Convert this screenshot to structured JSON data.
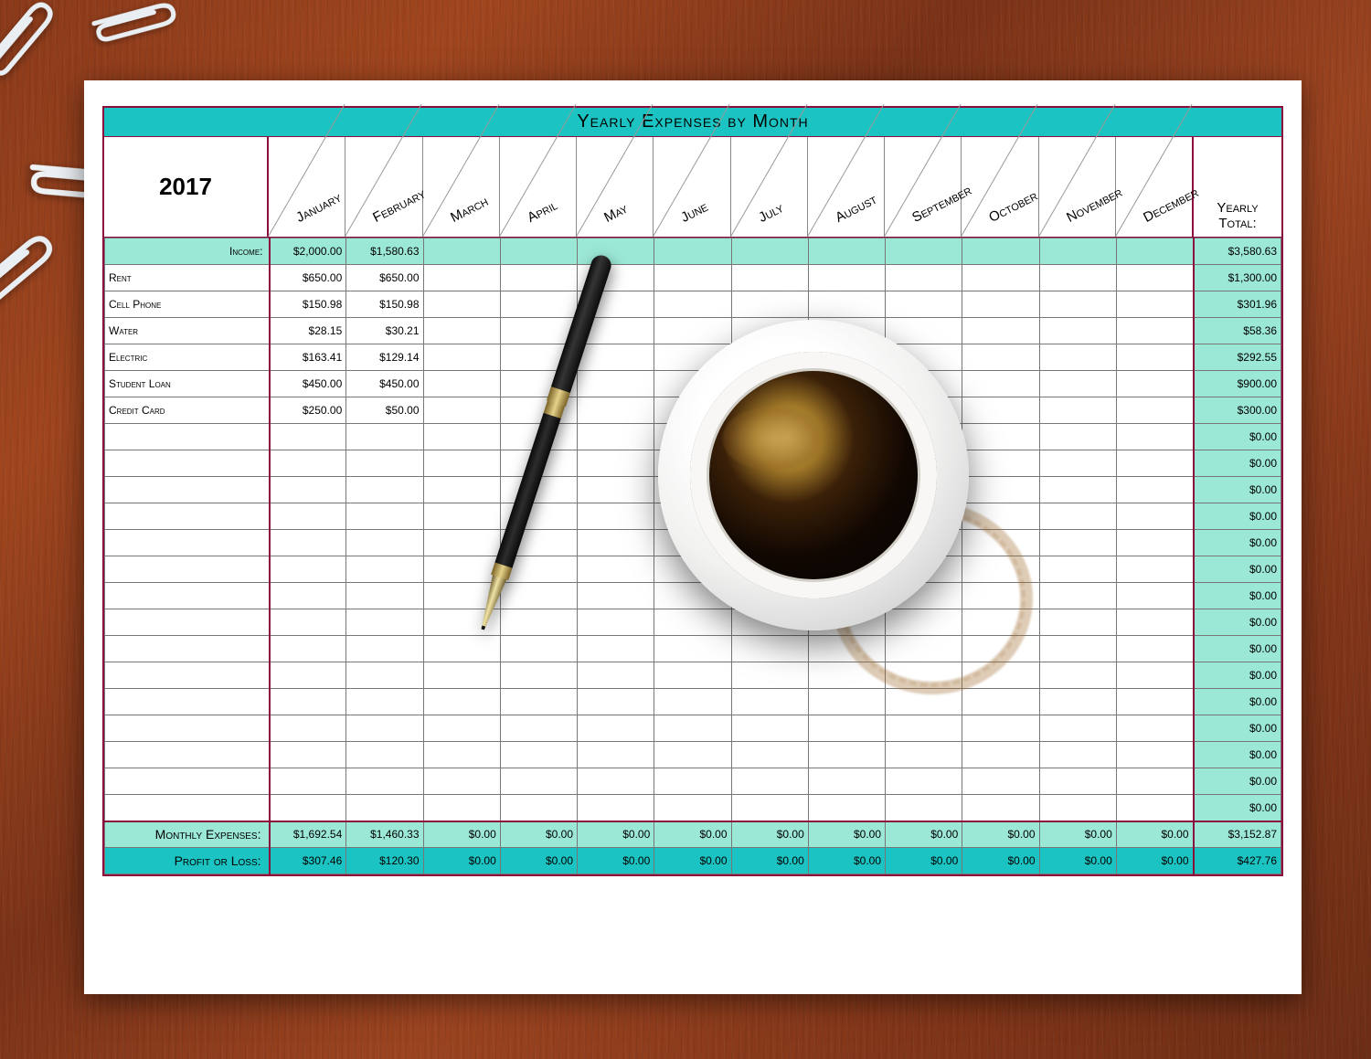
{
  "title": "Yearly Expenses by Month",
  "year": "2017",
  "total_head_l1": "Yearly",
  "total_head_l2": "Total:",
  "months": [
    "January",
    "February",
    "March",
    "April",
    "May",
    "June",
    "July",
    "August",
    "September",
    "October",
    "November",
    "December"
  ],
  "income": {
    "label": "Income:",
    "values": [
      "$2,000.00",
      "$1,580.63",
      "",
      "",
      "",
      "",
      "",
      "",
      "",
      "",
      "",
      ""
    ],
    "total": "$3,580.63"
  },
  "expenses": [
    {
      "label": "Rent",
      "values": [
        "$650.00",
        "$650.00",
        "",
        "",
        "",
        "",
        "",
        "",
        "",
        "",
        "",
        ""
      ],
      "total": "$1,300.00"
    },
    {
      "label": "Cell Phone",
      "values": [
        "$150.98",
        "$150.98",
        "",
        "",
        "",
        "",
        "",
        "",
        "",
        "",
        "",
        ""
      ],
      "total": "$301.96"
    },
    {
      "label": "Water",
      "values": [
        "$28.15",
        "$30.21",
        "",
        "",
        "",
        "",
        "",
        "",
        "",
        "",
        "",
        ""
      ],
      "total": "$58.36"
    },
    {
      "label": "Electric",
      "values": [
        "$163.41",
        "$129.14",
        "",
        "",
        "",
        "",
        "",
        "",
        "",
        "",
        "",
        ""
      ],
      "total": "$292.55"
    },
    {
      "label": "Student Loan",
      "values": [
        "$450.00",
        "$450.00",
        "",
        "",
        "",
        "",
        "",
        "",
        "",
        "",
        "",
        ""
      ],
      "total": "$900.00"
    },
    {
      "label": "Credit Card",
      "values": [
        "$250.00",
        "$50.00",
        "",
        "",
        "",
        "",
        "",
        "",
        "",
        "",
        "",
        ""
      ],
      "total": "$300.00"
    },
    {
      "label": "",
      "values": [
        "",
        "",
        "",
        "",
        "",
        "",
        "",
        "",
        "",
        "",
        "",
        ""
      ],
      "total": "$0.00"
    },
    {
      "label": "",
      "values": [
        "",
        "",
        "",
        "",
        "",
        "",
        "",
        "",
        "",
        "",
        "",
        ""
      ],
      "total": "$0.00"
    },
    {
      "label": "",
      "values": [
        "",
        "",
        "",
        "",
        "",
        "",
        "",
        "",
        "",
        "",
        "",
        ""
      ],
      "total": "$0.00"
    },
    {
      "label": "",
      "values": [
        "",
        "",
        "",
        "",
        "",
        "",
        "",
        "",
        "",
        "",
        "",
        ""
      ],
      "total": "$0.00"
    },
    {
      "label": "",
      "values": [
        "",
        "",
        "",
        "",
        "",
        "",
        "",
        "",
        "",
        "",
        "",
        ""
      ],
      "total": "$0.00"
    },
    {
      "label": "",
      "values": [
        "",
        "",
        "",
        "",
        "",
        "",
        "",
        "",
        "",
        "",
        "",
        ""
      ],
      "total": "$0.00"
    },
    {
      "label": "",
      "values": [
        "",
        "",
        "",
        "",
        "",
        "",
        "",
        "",
        "",
        "",
        "",
        ""
      ],
      "total": "$0.00"
    },
    {
      "label": "",
      "values": [
        "",
        "",
        "",
        "",
        "",
        "",
        "",
        "",
        "",
        "",
        "",
        ""
      ],
      "total": "$0.00"
    },
    {
      "label": "",
      "values": [
        "",
        "",
        "",
        "",
        "",
        "",
        "",
        "",
        "",
        "",
        "",
        ""
      ],
      "total": "$0.00"
    },
    {
      "label": "",
      "values": [
        "",
        "",
        "",
        "",
        "",
        "",
        "",
        "",
        "",
        "",
        "",
        ""
      ],
      "total": "$0.00"
    },
    {
      "label": "",
      "values": [
        "",
        "",
        "",
        "",
        "",
        "",
        "",
        "",
        "",
        "",
        "",
        ""
      ],
      "total": "$0.00"
    },
    {
      "label": "",
      "values": [
        "",
        "",
        "",
        "",
        "",
        "",
        "",
        "",
        "",
        "",
        "",
        ""
      ],
      "total": "$0.00"
    },
    {
      "label": "",
      "values": [
        "",
        "",
        "",
        "",
        "",
        "",
        "",
        "",
        "",
        "",
        "",
        ""
      ],
      "total": "$0.00"
    },
    {
      "label": "",
      "values": [
        "",
        "",
        "",
        "",
        "",
        "",
        "",
        "",
        "",
        "",
        "",
        ""
      ],
      "total": "$0.00"
    },
    {
      "label": "",
      "values": [
        "",
        "",
        "",
        "",
        "",
        "",
        "",
        "",
        "",
        "",
        "",
        ""
      ],
      "total": "$0.00"
    }
  ],
  "monthly_expenses": {
    "label": "Monthly Expenses:",
    "values": [
      "$1,692.54",
      "$1,460.33",
      "$0.00",
      "$0.00",
      "$0.00",
      "$0.00",
      "$0.00",
      "$0.00",
      "$0.00",
      "$0.00",
      "$0.00",
      "$0.00"
    ],
    "total": "$3,152.87"
  },
  "profit_loss": {
    "label": "Profit or Loss:",
    "values": [
      "$307.46",
      "$120.30",
      "$0.00",
      "$0.00",
      "$0.00",
      "$0.00",
      "$0.00",
      "$0.00",
      "$0.00",
      "$0.00",
      "$0.00",
      "$0.00"
    ],
    "total": "$427.76"
  }
}
